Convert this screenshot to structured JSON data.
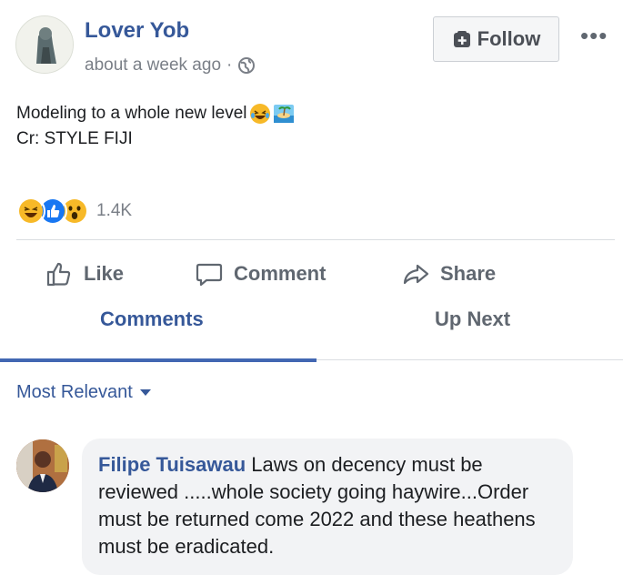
{
  "post": {
    "author": "Lover Yob",
    "timestamp": "about a week ago",
    "separator": "·",
    "privacy_icon": "globe-icon",
    "follow_label": "Follow",
    "more_label": "•••",
    "text_line1": "Modeling to a whole new level",
    "text_line2": "Cr: STYLE FIJI",
    "emojis": [
      "laughing-tears-emoji",
      "beach-emoji"
    ]
  },
  "reactions": {
    "types": [
      "haha",
      "like",
      "wow"
    ],
    "count": "1.4K"
  },
  "actions": {
    "like": "Like",
    "comment": "Comment",
    "share": "Share"
  },
  "tabs": {
    "comments": "Comments",
    "up_next": "Up Next",
    "active": "comments"
  },
  "sort": {
    "label": "Most Relevant"
  },
  "comment": {
    "name": "Filipe Tuisawau",
    "text": " Laws on decency must be reviewed .....whole society going haywire...Order must be returned come 2022 and these heathens must be eradicated."
  },
  "colors": {
    "brand": "#365899",
    "tab_underline": "#4267b2",
    "muted": "#606770"
  }
}
